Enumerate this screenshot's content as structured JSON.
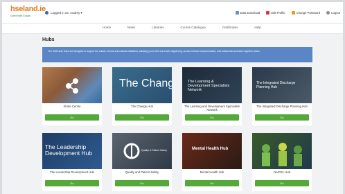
{
  "header": {
    "logo_main": "hseland.ie",
    "logo_sub": "Glemmite Eolais",
    "login_text": "Logged in as: Audrey ▾",
    "links": [
      "Data Download",
      "Edit Profile",
      "Change Password",
      "Logout"
    ]
  },
  "nav": [
    "Home",
    "News",
    "Libraries",
    "Course Catalogue",
    "Certificates",
    "Help"
  ],
  "page": {
    "title": "Hubs",
    "info": "The HSELanD Hubs are designed to support the culture of local and national initiatives, allowing you to find out what's happening, access relevant documentation, and collaborate and learn together online."
  },
  "hubs": [
    {
      "name": "Share Centre",
      "button": "Go",
      "image_text": ""
    },
    {
      "name": "The Change Hub",
      "button": "Go",
      "image_text": "The Change Hub"
    },
    {
      "name": "The Learning and Development Specialists Network",
      "button": "Go",
      "image_text": "The Learning & Development Specialists Network"
    },
    {
      "name": "The Integrated Discharge Planning Hub",
      "button": "Go",
      "image_text": "The Integrated Discharge Planning Hub"
    },
    {
      "name": "The Leadership Development Hub",
      "button": "Go",
      "image_text": "The Leadership Development Hub"
    },
    {
      "name": "Quality and Patient Safety",
      "button": "Go",
      "image_text": "Quality & Patient Safety"
    },
    {
      "name": "Mental Health Hub",
      "button": "Go",
      "image_text": "Mental Health Hub"
    },
    {
      "name": "NAICEL Hub",
      "button": "Go",
      "image_text": ""
    }
  ],
  "colors": {
    "logo_orange": "#e27a1a",
    "logo_green": "#2d8a3a",
    "info_blue": "#5b86c6",
    "go_green": "#55a83a"
  }
}
